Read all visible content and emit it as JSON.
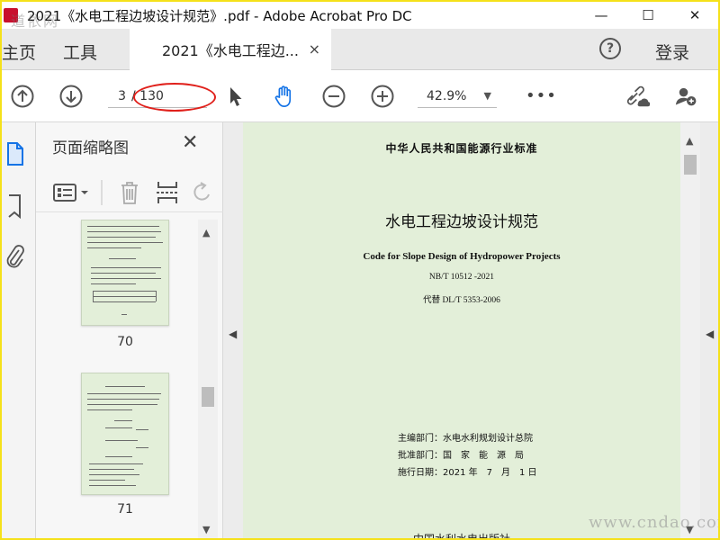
{
  "titlebar": {
    "title": "2021《水电工程边坡设计规范》.pdf - Adobe Acrobat Pro DC",
    "watermark": "道依网",
    "minimize": "—",
    "maximize": "☐",
    "close": "✕"
  },
  "tabs": {
    "home": "主页",
    "tools": "工具",
    "document": "2021《水电工程边...",
    "close": "×",
    "help": "?",
    "login": "登录"
  },
  "toolbar": {
    "current_page": "3",
    "total_pages": "/ 130",
    "zoom": "42.9%",
    "more": "•••"
  },
  "thumbnail_panel": {
    "title": "页面缩略图",
    "close": "✕",
    "pages": [
      {
        "label": "70"
      },
      {
        "label": "71"
      }
    ]
  },
  "document_page": {
    "header": "中华人民共和国能源行业标准",
    "title": "水电工程边坡设计规范",
    "english_title": "Code for Slope Design of Hydropower Projects",
    "code": "NB/T 10512 -2021",
    "replaces": "代替 DL/T 5353-2006",
    "editor": "主编部门：水电水利规划设计总院",
    "approver": "批准部门：国　家　能　源　局",
    "effective": "施行日期：2021 年　7　月　1 日",
    "publisher": "中国水利水电出版社"
  },
  "watermark_bottom": "www.cndao.com",
  "colors": {
    "highlight": "#e0201b",
    "page_bg": "#e3efd9",
    "border": "#f5e11a",
    "hand_tool": "#1473e6"
  }
}
